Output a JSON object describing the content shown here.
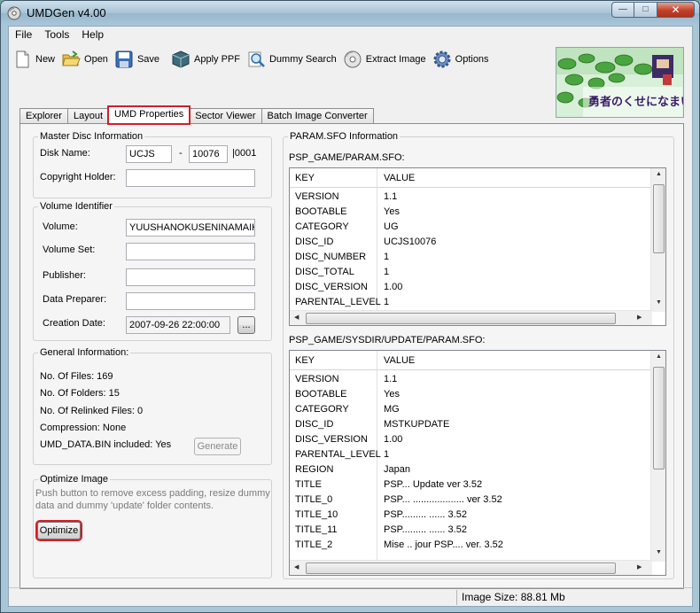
{
  "window": {
    "title": "UMDGen v4.00"
  },
  "menu": [
    "File",
    "Tools",
    "Help"
  ],
  "toolbar": {
    "new": "New",
    "open": "Open",
    "save": "Save",
    "apply_ppf": "Apply PPF",
    "dummy_search": "Dummy Search",
    "extract_image": "Extract Image",
    "options": "Options"
  },
  "banner": {
    "text": "勇者のくせになまいきだ"
  },
  "tabs": [
    "Explorer",
    "Layout",
    "UMD Properties",
    "Sector Viewer",
    "Batch Image Converter"
  ],
  "master_disc": {
    "title": "Master Disc Information",
    "disk_name_label": "Disk Name:",
    "disk_id_a": "UCJS",
    "dash": "-",
    "disk_id_b": "10076",
    "disk_suffix": "|0001",
    "copyright_label": "Copyright Holder:",
    "copyright_value": ""
  },
  "volume": {
    "title": "Volume Identifier",
    "volume_label": "Volume:",
    "volume_value": "YUUSHANOKUSENINAMAIKID",
    "volume_set_label": "Volume Set:",
    "volume_set_value": "",
    "publisher_label": "Publisher:",
    "publisher_value": "",
    "data_preparer_label": "Data Preparer:",
    "data_preparer_value": "",
    "creation_date_label": "Creation Date:",
    "creation_date_value": "2007-09-26 22:00:00",
    "browse_label": "..."
  },
  "general": {
    "title": "General Information:",
    "files": "No. Of Files: 169",
    "folders": "No. Of Folders: 15",
    "relinked": "No. Of Relinked Files: 0",
    "compression": "Compression: None",
    "umd_data": "UMD_DATA.BIN included: Yes",
    "generate_label": "Generate"
  },
  "optimize": {
    "title": "Optimize Image",
    "hint_line1": "Push button to remove excess padding, resize dummy",
    "hint_line2": "data and dummy 'update' folder contents.",
    "button": "Optimize"
  },
  "param_sfo": {
    "title": "PARAM.SFO Information",
    "grid1_label": "PSP_GAME/PARAM.SFO:",
    "grid2_label": "PSP_GAME/SYSDIR/UPDATE/PARAM.SFO:",
    "col_key": "KEY",
    "col_value": "VALUE",
    "grid1_rows": [
      [
        "VERSION",
        "1.1"
      ],
      [
        "BOOTABLE",
        "Yes"
      ],
      [
        "CATEGORY",
        "UG"
      ],
      [
        "DISC_ID",
        "UCJS10076"
      ],
      [
        "DISC_NUMBER",
        "1"
      ],
      [
        "DISC_TOTAL",
        "1"
      ],
      [
        "DISC_VERSION",
        "1.00"
      ],
      [
        "PARENTAL_LEVEL",
        "1"
      ]
    ],
    "grid2_rows": [
      [
        "VERSION",
        "1.1"
      ],
      [
        "BOOTABLE",
        "Yes"
      ],
      [
        "CATEGORY",
        "MG"
      ],
      [
        "DISC_ID",
        "MSTKUPDATE"
      ],
      [
        "DISC_VERSION",
        "1.00"
      ],
      [
        "PARENTAL_LEVEL",
        "1"
      ],
      [
        "REGION",
        "Japan"
      ],
      [
        "TITLE",
        "PSP... Update ver 3.52"
      ],
      [
        "TITLE_0",
        "PSP... ................... ver 3.52"
      ],
      [
        "TITLE_10",
        "PSP......... ...... 3.52"
      ],
      [
        "TITLE_11",
        "PSP......... ...... 3.52"
      ],
      [
        "TITLE_2",
        "Mise .. jour PSP.... ver. 3.52"
      ]
    ]
  },
  "status": {
    "image_size": "Image Size: 88.81 Mb"
  },
  "colors": {
    "highlight": "#d01f2b",
    "title_bar": "#a9c6d6"
  }
}
